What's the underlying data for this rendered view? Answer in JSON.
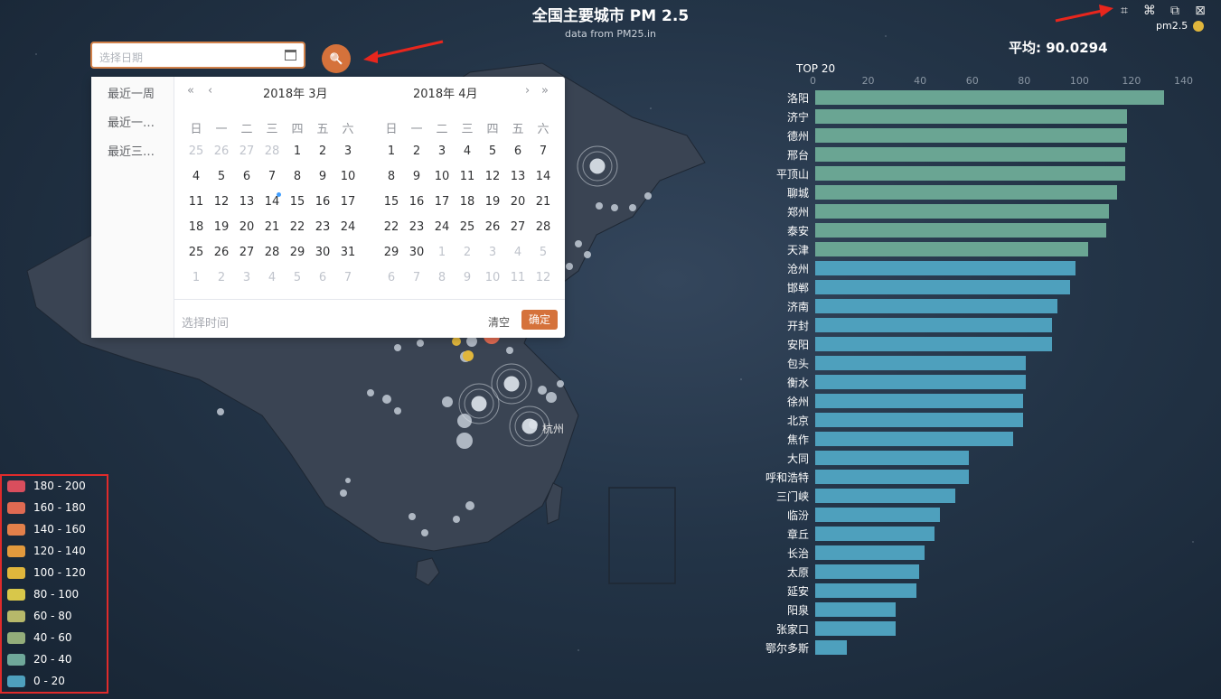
{
  "header": {
    "title": "全国主要城市 PM 2.5",
    "subtitle": "data from PM25.in",
    "average": "平均: 90.0294",
    "top_title": "TOP 20"
  },
  "toolbox": {
    "icons": [
      "zoom-select-icon",
      "lasso-select-icon",
      "restore-icon",
      "clear-selection-icon"
    ],
    "glyphs": [
      "⌗",
      "⌘",
      "⧉",
      "⊠"
    ]
  },
  "series_legend": {
    "label": "pm2.5",
    "color": "#e0b63c"
  },
  "date_picker": {
    "placeholder": "选择日期",
    "search_icon": "🔍",
    "shortcuts": [
      "最近一周",
      "最近一…",
      "最近三…"
    ],
    "nav_prev_year": "«",
    "nav_prev_month": "‹",
    "nav_next_month": "›",
    "nav_next_year": "»",
    "left_month": "2018年 3月",
    "right_month": "2018年 4月",
    "weekdays": [
      "日",
      "一",
      "二",
      "三",
      "四",
      "五",
      "六"
    ],
    "left_days": [
      [
        "25",
        "26",
        "27",
        "28",
        "1",
        "2",
        "3"
      ],
      [
        "4",
        "5",
        "6",
        "7",
        "8",
        "9",
        "10"
      ],
      [
        "11",
        "12",
        "13",
        "14",
        "15",
        "16",
        "17"
      ],
      [
        "18",
        "19",
        "20",
        "21",
        "22",
        "23",
        "24"
      ],
      [
        "25",
        "26",
        "27",
        "28",
        "29",
        "30",
        "31"
      ],
      [
        "1",
        "2",
        "3",
        "4",
        "5",
        "6",
        "7"
      ]
    ],
    "right_days": [
      [
        "1",
        "2",
        "3",
        "4",
        "5",
        "6",
        "7"
      ],
      [
        "8",
        "9",
        "10",
        "11",
        "12",
        "13",
        "14"
      ],
      [
        "15",
        "16",
        "17",
        "18",
        "19",
        "20",
        "21"
      ],
      [
        "22",
        "23",
        "24",
        "25",
        "26",
        "27",
        "28"
      ],
      [
        "29",
        "30",
        "1",
        "2",
        "3",
        "4",
        "5"
      ],
      [
        "6",
        "7",
        "8",
        "9",
        "10",
        "11",
        "12"
      ]
    ],
    "time_placeholder": "选择时间",
    "clear_label": "清空",
    "confirm_label": "确定"
  },
  "map": {
    "city_label": "杭州"
  },
  "visual_map": {
    "ranges": [
      {
        "label": "180 - 200",
        "color": "#d94e5d"
      },
      {
        "label": "160 - 180",
        "color": "#e06a52"
      },
      {
        "label": "140 - 160",
        "color": "#e3804a"
      },
      {
        "label": "120 - 140",
        "color": "#e39a3d"
      },
      {
        "label": "100 - 120",
        "color": "#e0b63c"
      },
      {
        "label": "80 - 100",
        "color": "#d8c74a"
      },
      {
        "label": "60 - 80",
        "color": "#b6b86a"
      },
      {
        "label": "40 - 60",
        "color": "#93ad7a"
      },
      {
        "label": "20 - 40",
        "color": "#6fa89a"
      },
      {
        "label": "0 - 20",
        "color": "#4ea0bd"
      }
    ]
  },
  "chart_data": {
    "type": "bar",
    "orientation": "horizontal",
    "title": "TOP 20",
    "xlim": [
      0,
      140
    ],
    "xticks": [
      0,
      20,
      40,
      60,
      80,
      100,
      120,
      140
    ],
    "categories": [
      "洛阳",
      "济宁",
      "德州",
      "邢台",
      "平顶山",
      "聊城",
      "郑州",
      "泰安",
      "天津",
      "沧州",
      "邯郸",
      "济南",
      "开封",
      "安阳",
      "包头",
      "衡水",
      "徐州",
      "北京",
      "焦作",
      "大同",
      "呼和浩特",
      "三门峡",
      "临汾",
      "章丘",
      "长治",
      "太原",
      "延安",
      "阳泉",
      "张家口",
      "鄂尔多斯"
    ],
    "values": [
      134,
      120,
      120,
      119,
      119,
      116,
      113,
      112,
      105,
      100,
      98,
      93,
      91,
      91,
      81,
      81,
      80,
      80,
      76,
      59,
      59,
      54,
      48,
      46,
      42,
      40,
      39,
      31,
      31,
      12
    ],
    "colors": {
      "high": "#6aa593",
      "low": "#4ea0bd",
      "threshold_index": 9
    }
  }
}
